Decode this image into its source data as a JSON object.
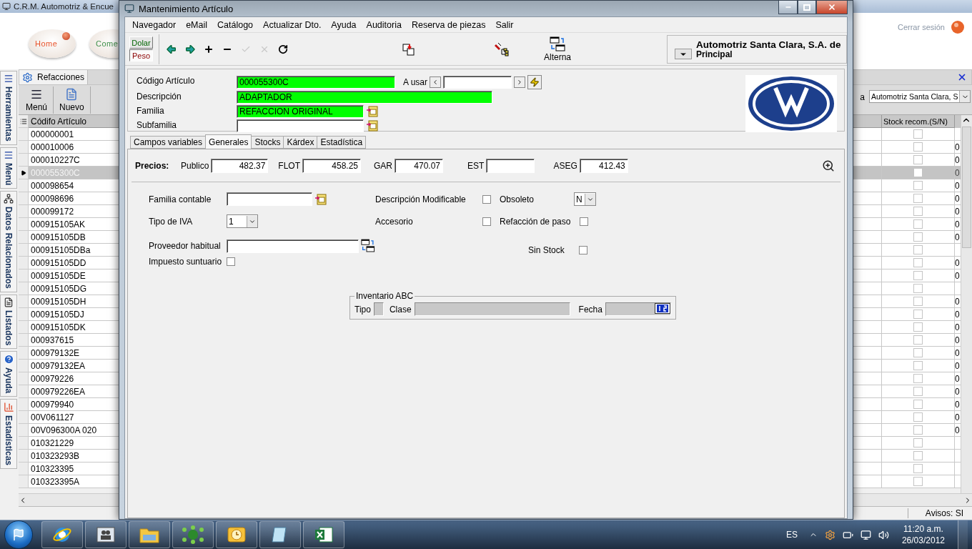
{
  "background_window": {
    "title": "C.R.M. Automotriz & Encue",
    "nav_buttons": [
      {
        "label": "Home",
        "color": "#e8542c"
      },
      {
        "label": "Come",
        "color": "#3f8f4a"
      }
    ],
    "logout": "Cerrar sesión",
    "side_tabs": [
      {
        "label": "Herramientas",
        "kind": "list"
      },
      {
        "label": "Menú",
        "kind": "list"
      },
      {
        "label": "Datos Relacionados",
        "kind": "tree"
      },
      {
        "label": "Listados",
        "kind": "report"
      },
      {
        "label": "Ayuda",
        "kind": "help"
      },
      {
        "label": "Estadísticas",
        "kind": "stats"
      }
    ],
    "panel_tab": "Refacciones",
    "toolbar": [
      {
        "label": "Menú",
        "kind": "menu"
      },
      {
        "label": "Nuevo",
        "kind": "new"
      }
    ],
    "filter_label": "a",
    "company_select": "Automotriz Santa Clara, S",
    "grid": {
      "columns": [
        "Códifo Artículo",
        "Stock recom.(S/N)"
      ],
      "rows": [
        {
          "code": "000000001",
          "selected": false,
          "stock_recom": false
        },
        {
          "code": "000010006",
          "selected": false,
          "stock_recom": false,
          "column_3": "0"
        },
        {
          "code": "000010227C",
          "selected": false,
          "stock_recom": false,
          "column_3": "0"
        },
        {
          "code": "000055300C",
          "selected": true,
          "stock_recom": false,
          "column_3": "0"
        },
        {
          "code": "000098654",
          "selected": false,
          "stock_recom": false,
          "column_3": "0"
        },
        {
          "code": "000098696",
          "selected": false,
          "stock_recom": false,
          "column_3": "0"
        },
        {
          "code": "000099172",
          "selected": false,
          "stock_recom": false,
          "column_3": "0"
        },
        {
          "code": "000915105AK",
          "selected": false,
          "stock_recom": false,
          "column_3": "0"
        },
        {
          "code": "000915105DB",
          "selected": false,
          "stock_recom": false,
          "column_3": "0"
        },
        {
          "code": "000915105DBa",
          "selected": false,
          "stock_recom": false
        },
        {
          "code": "000915105DD",
          "selected": false,
          "stock_recom": false,
          "column_3": "0"
        },
        {
          "code": "000915105DE",
          "selected": false,
          "stock_recom": false,
          "column_3": "0"
        },
        {
          "code": "000915105DG",
          "selected": false,
          "stock_recom": false
        },
        {
          "code": "000915105DH",
          "selected": false,
          "stock_recom": false,
          "column_3": "0"
        },
        {
          "code": "000915105DJ",
          "selected": false,
          "stock_recom": false,
          "column_3": "0"
        },
        {
          "code": "000915105DK",
          "selected": false,
          "stock_recom": false,
          "column_3": "0"
        },
        {
          "code": "000937615",
          "selected": false,
          "stock_recom": false,
          "column_3": "0"
        },
        {
          "code": "000979132E",
          "selected": false,
          "stock_recom": false,
          "column_3": "0"
        },
        {
          "code": "000979132EA",
          "selected": false,
          "stock_recom": false,
          "column_3": "0"
        },
        {
          "code": "000979226",
          "selected": false,
          "stock_recom": false,
          "column_3": "0"
        },
        {
          "code": "000979226EA",
          "selected": false,
          "stock_recom": false,
          "column_3": "0"
        },
        {
          "code": "000979940",
          "selected": false,
          "stock_recom": false,
          "column_3": "0"
        },
        {
          "code": "00V061127",
          "selected": false,
          "stock_recom": false,
          "column_3": "0"
        },
        {
          "code": "00V096300A 020",
          "selected": false,
          "stock_recom": false,
          "column_3": "0"
        },
        {
          "code": "010321229",
          "selected": false,
          "stock_recom": false
        },
        {
          "code": "010323293B",
          "selected": false,
          "stock_recom": false
        },
        {
          "code": "010323395",
          "selected": false,
          "stock_recom": false
        },
        {
          "code": "010323395A",
          "selected": false,
          "stock_recom": false
        }
      ]
    },
    "status": "Avisos: SI"
  },
  "dialog": {
    "title": "Mantenimiento Artículo",
    "menu": [
      "Navegador",
      "eMail",
      "Catálogo",
      "Actualizar Dto.",
      "Ayuda",
      "Auditoria",
      "Reserva de piezas",
      "Salir"
    ],
    "currency": [
      {
        "label": "Dolar",
        "selected": false
      },
      {
        "label": "Peso",
        "selected": true
      }
    ],
    "nav_tools": [
      {
        "kind": "back",
        "disabled": false
      },
      {
        "kind": "forward",
        "disabled": false
      },
      {
        "kind": "add",
        "disabled": false
      },
      {
        "kind": "remove",
        "disabled": false
      },
      {
        "kind": "accept",
        "disabled": true
      },
      {
        "kind": "cancel",
        "disabled": true
      },
      {
        "kind": "refresh",
        "disabled": false
      }
    ],
    "alterna": "Alterna",
    "company": {
      "name": "Automotriz Santa Clara, S.A. de",
      "branch": "Principal"
    },
    "header_fields": [
      {
        "label": "Código Artículo",
        "value": "000055300C",
        "highlighted": true,
        "kind": "code"
      },
      {
        "label": "Descripción",
        "value": "ADAPTADOR",
        "highlighted": true,
        "kind": "wide"
      },
      {
        "label": "Familia",
        "value": "REFACCION ORIGINAL",
        "highlighted": true,
        "kind": "lookup"
      },
      {
        "label": "Subfamilia",
        "highlighted": false,
        "kind": "lookup"
      }
    ],
    "a_usar": "A usar",
    "tabs": [
      {
        "label": "Campos variables",
        "selected": false
      },
      {
        "label": "Generales",
        "selected": true
      },
      {
        "label": "Stocks",
        "selected": false
      },
      {
        "label": "Kárdex",
        "selected": false
      },
      {
        "label": "Estadística",
        "selected": false
      }
    ],
    "prices": {
      "label": "Precios:",
      "items": [
        {
          "label": "Publico",
          "value": "482.37"
        },
        {
          "label": "FLOT",
          "value": "458.25"
        },
        {
          "label": "GAR",
          "value": "470.07"
        },
        {
          "label": "EST"
        },
        {
          "label": "ASEG",
          "value": "412.43"
        }
      ]
    },
    "general": {
      "familia_contable": "Familia contable",
      "descripcion_modificable": {
        "label": "Descripción Modificable",
        "checked": false
      },
      "obsoleto": {
        "label": "Obsoleto",
        "value": "N"
      },
      "tipo_iva": {
        "label": "Tipo de IVA",
        "value": "1"
      },
      "accesorio": {
        "label": "Accesorio",
        "checked": false
      },
      "refaccion_de_paso": {
        "label": "Refacción de paso",
        "checked": false
      },
      "proveedor": "Proveedor habitual",
      "sin_stock": {
        "label": "Sin Stock",
        "checked": false
      },
      "impuesto_suntuario": {
        "label": "Impuesto suntuario",
        "checked": false
      }
    },
    "inventory": {
      "title": "Inventario ABC",
      "tipo": "Tipo",
      "clase": "Clase",
      "fecha": "Fecha"
    }
  },
  "taskbar": {
    "apps": [
      {
        "kind": "browser"
      },
      {
        "kind": "contacts"
      },
      {
        "kind": "folder"
      },
      {
        "kind": "network"
      },
      {
        "kind": "mail"
      },
      {
        "kind": "notepad"
      },
      {
        "kind": "sheet"
      }
    ],
    "language": "ES",
    "time": "11:20 a.m.",
    "date": "26/03/2012"
  }
}
